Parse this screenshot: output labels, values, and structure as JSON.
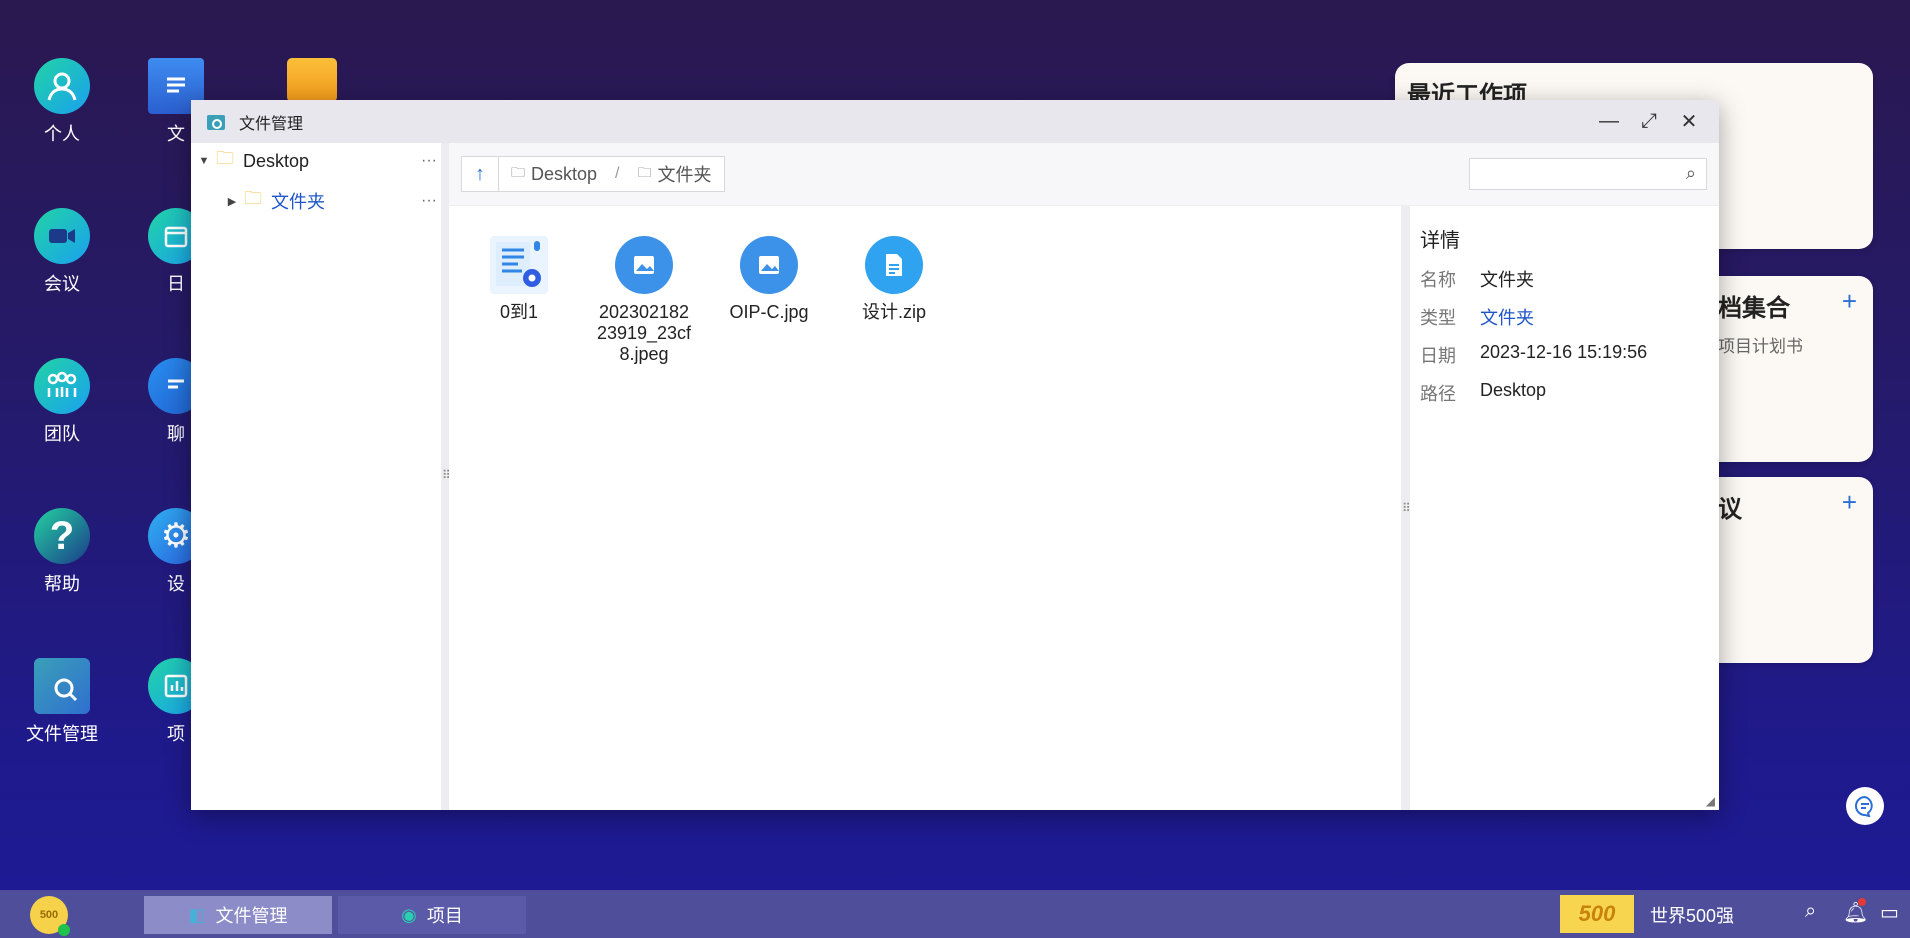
{
  "desktop": {
    "icons": [
      {
        "label": "个人",
        "icon": "person-icon"
      },
      {
        "label": "会议",
        "icon": "video-camera-icon"
      },
      {
        "label": "团队",
        "icon": "team-icon"
      },
      {
        "label": "帮助",
        "icon": "help-icon"
      },
      {
        "label": "文件管理",
        "icon": "file-manager-icon"
      }
    ],
    "partial_icons": [
      {
        "label": "文",
        "icon": "document-icon"
      },
      {
        "label": "日",
        "icon": "calendar-icon"
      },
      {
        "label": "聊",
        "icon": "chat-icon"
      },
      {
        "label": "设",
        "icon": "settings-icon"
      },
      {
        "label": "项",
        "icon": "project-icon"
      }
    ]
  },
  "cards": {
    "recent": {
      "title": "最近工作项"
    },
    "docs": {
      "title": "档集合",
      "item": "项目计划书"
    },
    "meeting": {
      "title": "议"
    }
  },
  "window": {
    "title": "文件管理",
    "controls": {
      "minimize": "—",
      "maximize": "⤢",
      "close": "✕"
    },
    "tree": {
      "root": "Desktop",
      "child": "文件夹",
      "more": "···"
    },
    "breadcrumb": {
      "up": "↑",
      "items": [
        "Desktop",
        "文件夹"
      ],
      "separator": "/"
    },
    "search": {
      "placeholder": ""
    },
    "files": [
      {
        "name": "0到1",
        "type": "doc-settings"
      },
      {
        "name": "20230218223919_23cf8.jpeg",
        "type": "image"
      },
      {
        "name": "OIP-C.jpg",
        "type": "image"
      },
      {
        "name": "设计.zip",
        "type": "file"
      }
    ],
    "details": {
      "title": "详情",
      "rows": [
        {
          "key": "名称",
          "value": "文件夹"
        },
        {
          "key": "类型",
          "value": "文件夹"
        },
        {
          "key": "日期",
          "value": "2023-12-16 15:19:56"
        },
        {
          "key": "路径",
          "value": "Desktop"
        }
      ]
    }
  },
  "taskbar": {
    "tasks": [
      {
        "label": "文件管理",
        "active": true
      },
      {
        "label": "项目",
        "active": false
      }
    ],
    "tray_text": "世界500强",
    "badge_text": "500"
  },
  "colors": {
    "accent": "#2b6fd6",
    "link": "#1e56c8",
    "folder": "#f2c14e"
  }
}
